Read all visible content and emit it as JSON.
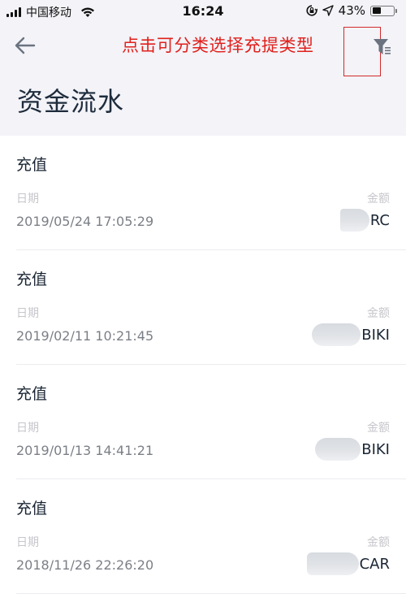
{
  "status_bar": {
    "carrier": "中国移动",
    "time": "16:24",
    "battery": "43%",
    "battery_level": 0.43,
    "icons": [
      "signal-icon",
      "wifi-icon",
      "rotation-lock-icon",
      "location-icon",
      "battery-icon"
    ]
  },
  "nav": {
    "back_icon": "arrow-left-icon",
    "filter_icon": "filter-list-icon",
    "annotation": "点击可分类选择充提类型"
  },
  "page": {
    "title": "资金流水"
  },
  "labels": {
    "date": "日期",
    "amount": "金额"
  },
  "colors": {
    "header_bg": "#f3f3f8",
    "annotation_red": "#e0201c",
    "title_dark": "#1e2c3c"
  },
  "records": [
    {
      "type": "充值",
      "date_label": "日期",
      "amount_label": "金额",
      "date": "2019/05/24 17:05:29",
      "amount_hidden": true,
      "currency": "RC"
    },
    {
      "type": "充值",
      "date_label": "日期",
      "amount_label": "金额",
      "date": "2019/02/11 10:21:45",
      "amount_hidden": true,
      "currency": "BIKI"
    },
    {
      "type": "充值",
      "date_label": "日期",
      "amount_label": "金额",
      "date": "2019/01/13 14:41:21",
      "amount_hidden": true,
      "currency": "BIKI"
    },
    {
      "type": "充值",
      "date_label": "日期",
      "amount_label": "金额",
      "date": "2018/11/26 22:26:20",
      "amount_hidden": true,
      "currency": "CAR"
    }
  ]
}
